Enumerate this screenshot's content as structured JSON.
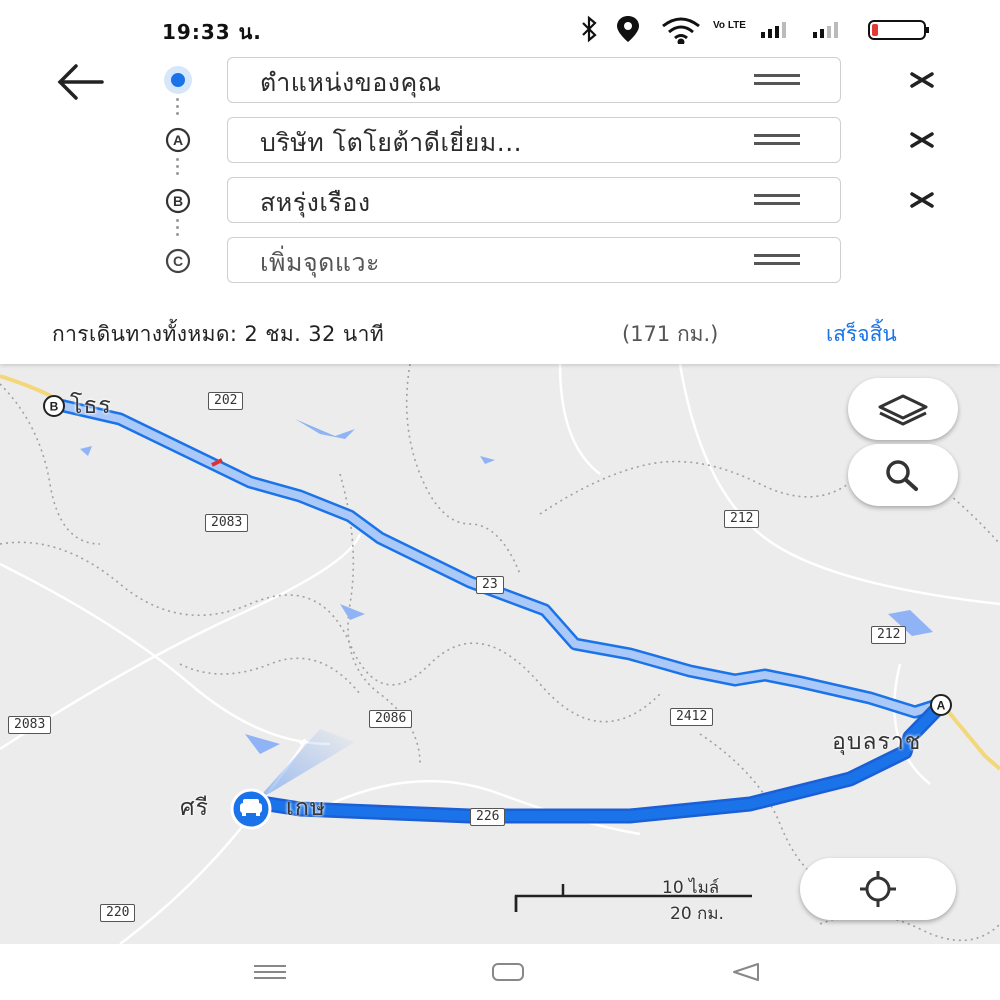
{
  "status_bar": {
    "time": "19:33 น.",
    "icons": [
      "bluetooth-icon",
      "location-icon",
      "wifi-icon",
      "volte-icon",
      "signal-icon",
      "signal-icon",
      "battery-icon"
    ],
    "volte_text": "Vo LTE",
    "battery_level": 0.12,
    "battery_color": "#e53935"
  },
  "directions": {
    "stops": [
      {
        "marker": "",
        "text": "ตำแหน่งของคุณ",
        "removable": true
      },
      {
        "marker": "A",
        "text": "บริษัท โตโยต้าดีเยี่ยม...",
        "removable": true
      },
      {
        "marker": "B",
        "text": "สหรุ่งเรือง",
        "removable": true
      },
      {
        "marker": "C",
        "text": "เพิ่มจุดแวะ",
        "removable": false,
        "placeholder": true
      }
    ]
  },
  "summary": {
    "label": "การเดินทางทั้งหมด: 2 ชม. 32 นาที",
    "distance": "(171 กม.)",
    "done": "เสร็จสิ้น"
  },
  "map": {
    "route_color": "#1a73e8",
    "route_alt_color": "#aac8f8",
    "road_shields": [
      "202",
      "2083",
      "23",
      "212",
      "212",
      "2086",
      "2412",
      "2083",
      "226",
      "220"
    ],
    "places": [
      "โธร",
      "อุบลราช",
      "ศรี",
      "เกษ"
    ],
    "markers": [
      "B",
      "A"
    ],
    "scale": {
      "miles": "10 ไมล์",
      "km": "20 กม."
    }
  },
  "nav": [
    "menu-button",
    "home-button",
    "back-button"
  ]
}
